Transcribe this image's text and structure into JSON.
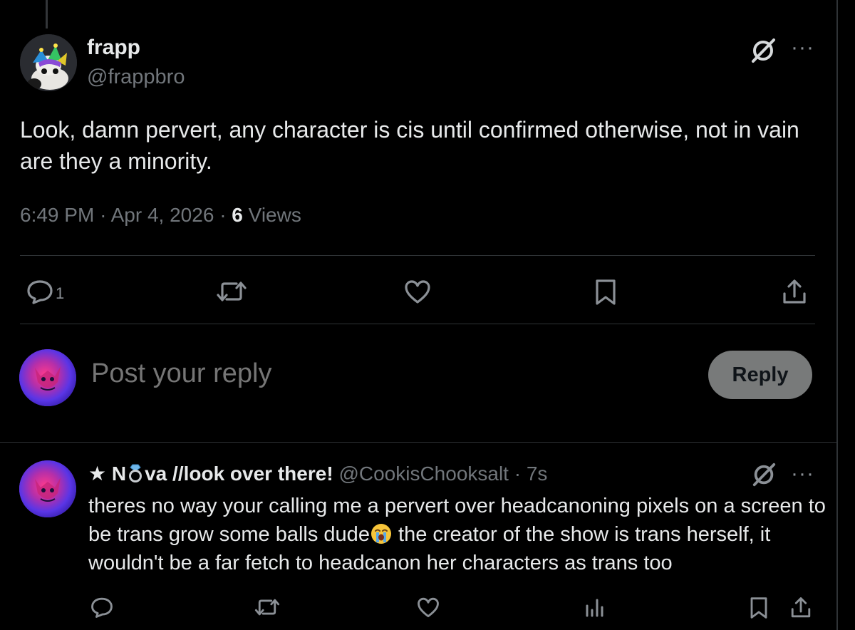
{
  "main_tweet": {
    "author_name": "frapp",
    "author_handle": "@frappbro",
    "text": "Look, damn pervert, any character is cis until confirmed otherwise, not in vain are they a minority.",
    "time": "6:49 PM",
    "separator": "·",
    "date": "Apr 4, 2026",
    "views_count": "6",
    "views_label": "Views",
    "reply_count": "1",
    "grok_icon": "grok-icon",
    "more_icon": "more-icon"
  },
  "compose": {
    "placeholder": "Post your reply",
    "button_label": "Reply"
  },
  "reply_tweet": {
    "display_name_prefix": "★ N",
    "display_name_suffix": "va //look over there!",
    "ring_emoji": "ring-icon",
    "handle": "@CookisChooksalt",
    "separator": "·",
    "time_ago": "7s",
    "text_part1": "theres no way your calling me a pervert over headcanoning pixels on a screen to be trans grow some balls dude",
    "crying_emoji": "loudly-crying-face-icon",
    "text_part2": " the creator of the show is trans herself, it wouldn't be a far fetch to headcanon her characters as trans too"
  },
  "colors": {
    "background": "#000000",
    "text_primary": "#e7e9ea",
    "text_secondary": "#71767b",
    "divider": "#2f3336",
    "reply_button_bg": "#787a7a"
  }
}
